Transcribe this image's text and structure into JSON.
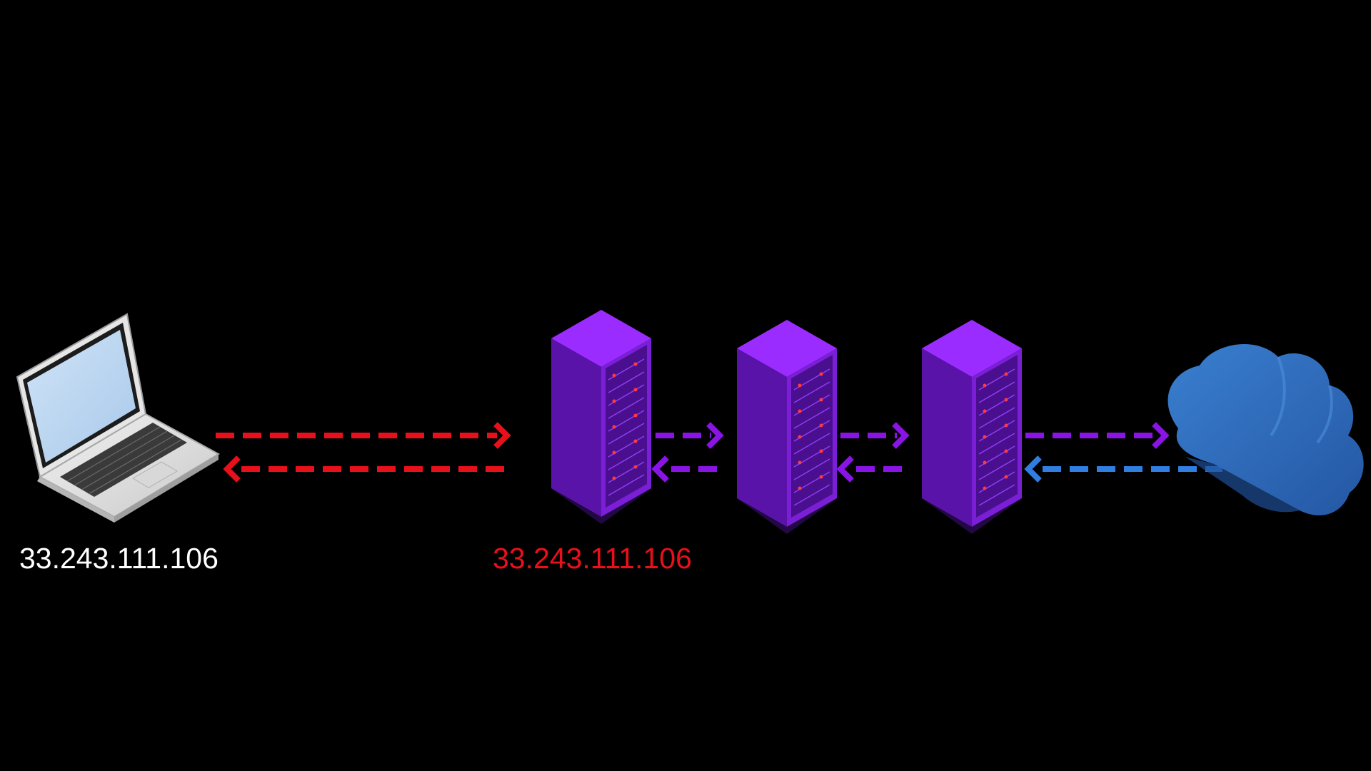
{
  "colors": {
    "background": "#000000",
    "client_ip_text": "#ffffff",
    "node_ip_text": "#e8101a",
    "client_link": "#e8101a",
    "relay_link": "#8a14e6",
    "cloud_link": "#2f7fe0",
    "server_rack": "#7a1fd6",
    "cloud": "#2f6fc4"
  },
  "icons": {
    "client": "laptop-icon",
    "servers": [
      "server-rack-icon",
      "server-rack-icon",
      "server-rack-icon"
    ],
    "destination": "cloud-icon"
  },
  "labels": {
    "client_ip": "33.243.111.106",
    "entry_node_ip": "33.243.111.106"
  }
}
